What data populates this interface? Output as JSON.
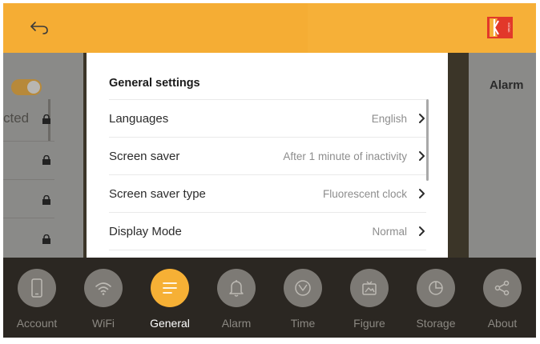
{
  "header": {
    "back_icon": "back-arrow-icon",
    "logo": "kodak-logo",
    "logo_text": "KODAK",
    "accent": "#f5ad34",
    "logo_color": "#e2382a"
  },
  "background": {
    "left_status": "cted",
    "right_title": "Alarm"
  },
  "dialog": {
    "title": "General settings",
    "items": [
      {
        "label": "Languages",
        "value": "English"
      },
      {
        "label": "Screen saver",
        "value": "After 1 minute of inactivity"
      },
      {
        "label": "Screen saver type",
        "value": "Fluorescent clock"
      },
      {
        "label": "Display Mode",
        "value": "Normal"
      }
    ]
  },
  "nav": {
    "items": [
      {
        "label": "Account",
        "icon": "phone-icon"
      },
      {
        "label": "WiFi",
        "icon": "wifi-icon"
      },
      {
        "label": "General",
        "icon": "menu-lines-icon",
        "active": true
      },
      {
        "label": "Alarm",
        "icon": "bell-icon"
      },
      {
        "label": "Time",
        "icon": "clock-icon"
      },
      {
        "label": "Figure",
        "icon": "image-icon"
      },
      {
        "label": "Storage",
        "icon": "pie-chart-icon"
      },
      {
        "label": "About",
        "icon": "share-icon"
      }
    ]
  }
}
